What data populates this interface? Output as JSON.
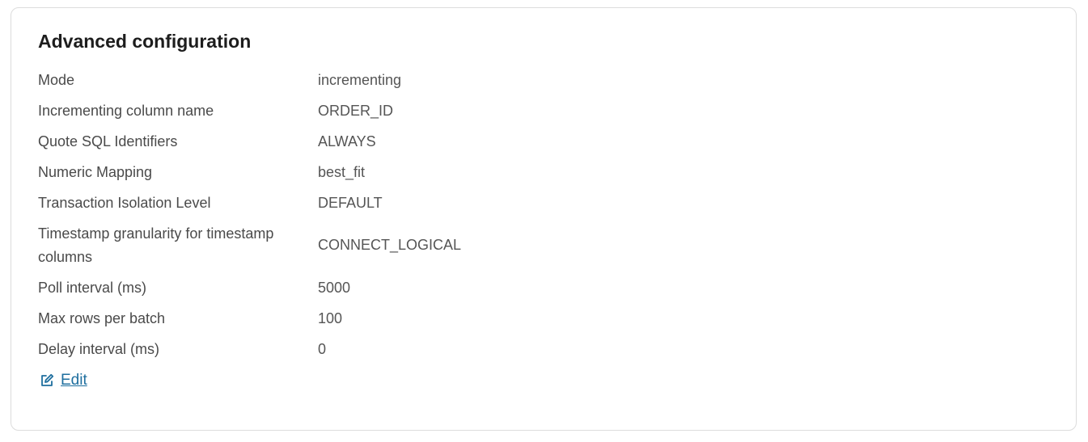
{
  "panel": {
    "title": "Advanced configuration",
    "rows": [
      {
        "label": "Mode",
        "value": "incrementing"
      },
      {
        "label": "Incrementing column name",
        "value": "ORDER_ID"
      },
      {
        "label": "Quote SQL Identifiers",
        "value": "ALWAYS"
      },
      {
        "label": "Numeric Mapping",
        "value": "best_fit"
      },
      {
        "label": "Transaction Isolation Level",
        "value": "DEFAULT"
      },
      {
        "label": "Timestamp granularity for timestamp columns",
        "value": "CONNECT_LOGICAL"
      },
      {
        "label": "Poll interval (ms)",
        "value": "5000"
      },
      {
        "label": "Max rows per batch",
        "value": "100"
      },
      {
        "label": "Delay interval (ms)",
        "value": "0"
      }
    ],
    "edit_label": "Edit",
    "edit_icon": "edit-icon",
    "link_color": "#1f6f9f"
  }
}
